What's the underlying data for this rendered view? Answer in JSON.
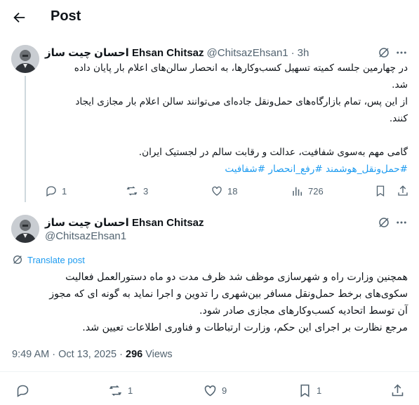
{
  "header": {
    "title": "Post"
  },
  "reply_tweet": {
    "author_name": "احسان چیت ساز Ehsan Chitsaz",
    "handle": "@ChitsazEhsan1",
    "separator": "·",
    "time": "3h",
    "lines": [
      "در چهارمین جلسه کمیته تسهیل کسب‌وکارها، به انحصار سالن‌های اعلام بار پایان داده",
      "شد.",
      "از این پس، تمام بازارگاه‌های حمل‌ونقل جاده‌ای می‌توانند سالن  اعلام بار مجازی ایجاد",
      "کنند.",
      "",
      "گامی مهم به‌سوی شفافیت، عدالت و رقابت سالم در لجستیک ایران."
    ],
    "hashtags": "#حمل‌ونقل_هوشمند #رفع_انحصار #شفافیت",
    "actions": {
      "replies": "1",
      "reposts": "3",
      "likes": "18",
      "views": "726"
    }
  },
  "main_tweet": {
    "author_name": "احسان چیت ساز Ehsan Chitsaz",
    "handle": "@ChitsazEhsan1",
    "translate_label": "Translate post",
    "lines": [
      "همچنین وزارت راه و شهرسازی موظف شد ظرف مدت دو ماه دستورالعمل فعالیت",
      "سکوی‌های برخط حمل‌ونقل مسافر بین‌شهری را تدوین و اجرا نماید به گونه ای که مجوز",
      "آن  توسط اتحادیه کسب‌وکارهای مجازی صادر شود.",
      "مرجع نظارت بر اجرای این حکم، وزارت ارتباطات و فناوری اطلاعات تعیین شد."
    ],
    "timestamp": "9:49 AM · Oct 13, 2025 · ",
    "views_count": "296",
    "views_label": " Views",
    "actions": {
      "replies": "",
      "reposts": "1",
      "likes": "9",
      "bookmarks": "1"
    }
  },
  "icons": [
    "back-arrow-icon",
    "grok-icon",
    "more-icon",
    "reply-icon",
    "repost-icon",
    "like-icon",
    "views-icon",
    "bookmark-icon",
    "share-icon",
    "translate-icon"
  ]
}
